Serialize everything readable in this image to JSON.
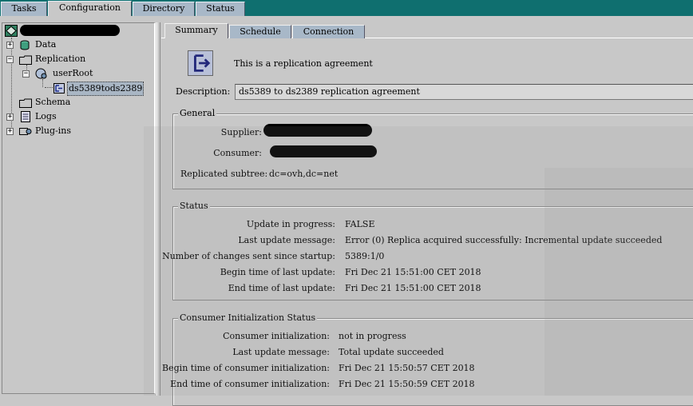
{
  "top_tabs": [
    {
      "label": "Tasks"
    },
    {
      "label": "Configuration"
    },
    {
      "label": "Directory"
    },
    {
      "label": "Status"
    }
  ],
  "tree": {
    "root_label": "",
    "items": {
      "data": "Data",
      "replication": "Replication",
      "userroot": "userRoot",
      "agreement": "ds5389tods2389",
      "schema": "Schema",
      "logs": "Logs",
      "plugins": "Plug-ins"
    }
  },
  "sub_tabs": [
    {
      "label": "Summary"
    },
    {
      "label": "Schedule"
    },
    {
      "label": "Connection"
    }
  ],
  "summary": {
    "intro": "This is a replication agreement",
    "description_label": "Description:",
    "description_value": "ds5389 to ds2389 replication agreement"
  },
  "general": {
    "title": "General",
    "supplier_label": "Supplier:",
    "consumer_label": "Consumer:",
    "subtree_label": "Replicated subtree:",
    "subtree_value": "dc=ovh,dc=net"
  },
  "status": {
    "title": "Status",
    "rows": [
      {
        "label": "Update in progress:",
        "value": "FALSE"
      },
      {
        "label": "Last update message:",
        "value": "Error (0) Replica acquired successfully: Incremental update succeeded"
      },
      {
        "label": "Number of changes sent since startup:",
        "value": "5389:1/0"
      },
      {
        "label": "Begin time of last update:",
        "value": "Fri Dec 21 15:51:00 CET 2018"
      },
      {
        "label": "End time of last update:",
        "value": "Fri Dec 21 15:51:00 CET 2018"
      }
    ]
  },
  "consumer_init": {
    "title": "Consumer Initialization Status",
    "rows": [
      {
        "label": "Consumer initialization:",
        "value": "not in progress"
      },
      {
        "label": "Last update message:",
        "value": "Total update succeeded"
      },
      {
        "label": "Begin time of consumer initialization:",
        "value": "Fri Dec 21 15:50:57 CET 2018"
      },
      {
        "label": "End time of consumer initialization:",
        "value": "Fri Dec 21 15:50:59 CET 2018"
      }
    ]
  },
  "colors": {
    "topbar": "#0f6f6f",
    "tab_inactive": "#a8b8c8",
    "panel_bg": "#c8c8c8",
    "selection": "#a9b6c4"
  }
}
